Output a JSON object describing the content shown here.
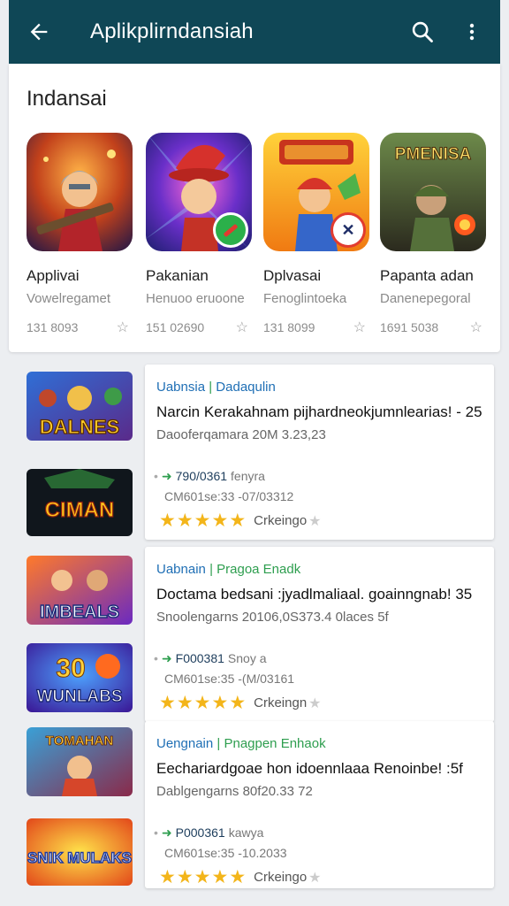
{
  "appbar": {
    "title": "Aplikplirndansiah",
    "back_icon": "arrow-left-icon",
    "search_icon": "search-icon",
    "more_icon": "more-vert-icon",
    "color": "#0f4756"
  },
  "featured": {
    "section_title": "Indansai",
    "apps": [
      {
        "name": "Applivai",
        "subtitle": "Vowelregamet",
        "count": "131 8093",
        "icon_art": "armored-warrior"
      },
      {
        "name": "Pakanian",
        "subtitle": "Henuoo eruoone",
        "count": "151 02690",
        "icon_art": "wizard-hero",
        "badge": "green-check-badge"
      },
      {
        "name": "Dplvasai",
        "subtitle": "Fenoglintoeka",
        "count": "131 8099",
        "icon_art": "red-hero-builder",
        "badge": "cross-tools-badge"
      },
      {
        "name": "Papanta adan",
        "subtitle": "Danenepegoral",
        "count": "1691 5038",
        "icon_art": "soldier-battle",
        "logo_text": "PMENISA"
      }
    ]
  },
  "listings": [
    {
      "category_a": "Uabnsia",
      "category_b": "Dadaqulin",
      "headline": "Narcin Kerakahnam pijhardneokjumnlearias! - 25",
      "subline": "Daooferqamara 20M 3.23,23",
      "downloads": "790/0361",
      "downloads_extra": "fenyra",
      "size_line": "CM601se:33 -07/03312",
      "rating_text": "Crkeingo",
      "thumbs": [
        {
          "art": "game-logo-dalnes",
          "text": "DALNES"
        },
        {
          "art": "game-logo-ciman",
          "text": "CIMAN"
        }
      ]
    },
    {
      "category_a": "Uabnain",
      "category_b": "Pragoa Enadk",
      "headline": "Doctama bedsani :jyadlmaliaal. goainngnab! 35",
      "subline": "Snoolengarns 20106,0S373.4 0laces 5f",
      "downloads": "F000381",
      "downloads_extra": "Snoy a",
      "size_line": "CM601se:35 -(M/03161",
      "rating_text": "Crkeingn",
      "thumbs": [
        {
          "art": "game-logo-imbeals",
          "text": "IMBEALS"
        },
        {
          "art": "game-logo-wunlabs",
          "text": "WUNLABS",
          "number": "30"
        }
      ]
    },
    {
      "category_a": "Uengnain",
      "category_b": "Pnagpen Enhaok",
      "headline": "Eechariardgoae hon idoennlaaa Renoinbe! :5f",
      "subline": "Dablgengarns 80f20.33 72",
      "downloads": "P000361",
      "downloads_extra": "kawya",
      "size_line": "CM601se:35 -10.2033",
      "rating_text": "Crkeingo",
      "thumbs": [
        {
          "art": "game-logo-tomahan",
          "text": "TOMAHAN"
        },
        {
          "art": "game-logo-snik-mulaks",
          "text": "SNIK MULAKS"
        }
      ]
    }
  ]
}
